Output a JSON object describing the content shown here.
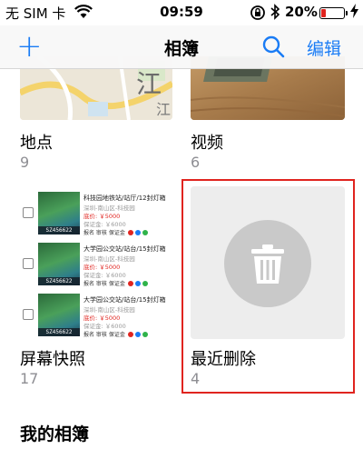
{
  "status_bar": {
    "carrier": "无 SIM 卡",
    "time": "09:59",
    "battery_percent": "20%",
    "battery_level": 0.2,
    "battery_color": "#e0241f"
  },
  "nav": {
    "add_label": "+",
    "title": "相簿",
    "edit_label": "编辑",
    "accent_color": "#1a7cf5"
  },
  "albums": [
    {
      "name": "地点",
      "count": "9",
      "map_text": [
        "江",
        "江"
      ]
    },
    {
      "name": "视频",
      "count": "6"
    },
    {
      "name": "屏幕快照",
      "count": "17"
    },
    {
      "name": "最近删除",
      "count": "4"
    }
  ],
  "screenshot_rows": [
    {
      "title": "科技园地铁站/站厅/12封灯箱",
      "location": "深圳-南山区-科技园",
      "price": "底价: ￥5000",
      "deposit": "保证金: ￥6000",
      "code": "SZ456622",
      "tags": "报名  审核  保证金"
    },
    {
      "title": "大学园公交站/站台/15封灯箱",
      "location": "深圳-南山区-科技园",
      "price": "底价: ￥5000",
      "deposit": "保证金: ￥6000",
      "code": "SZ456622",
      "tags": "报名  审核  保证金"
    },
    {
      "title": "大学园公交站/站台/15封灯箱",
      "location": "深圳-南山区-科技园",
      "price": "底价: ￥5000",
      "deposit": "保证金: ￥6000",
      "code": "SZ456622",
      "tags": "报名  审核  保证金"
    }
  ],
  "section_title": "我的相簿",
  "icons": [
    "wifi-icon",
    "rotation-lock-icon",
    "bluetooth-icon",
    "battery-icon",
    "charging-icon",
    "search-icon",
    "trash-icon"
  ],
  "highlight_color": "#e0241f"
}
